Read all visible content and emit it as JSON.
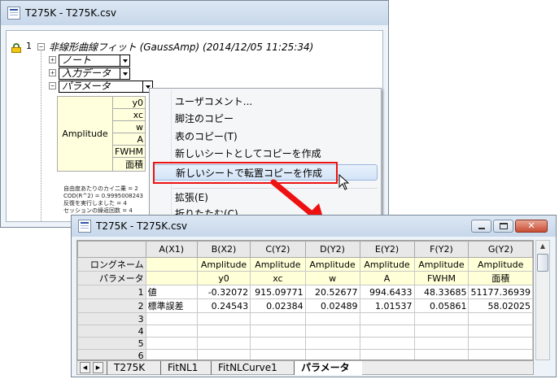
{
  "back_window": {
    "title": "T275K - T275K.csv",
    "row_number": "1",
    "report_title": "非線形曲線フィット (GaussAmp) (2014/12/05 11:25:34)",
    "tree_nodes": [
      "ノート",
      "入力データ",
      "パラメータ"
    ],
    "param_table": {
      "group": "Amplitude",
      "labels": [
        "y0",
        "xc",
        "w",
        "A",
        "FWHM",
        "面積"
      ]
    },
    "summary_lines": [
      "自由度あたりのカイ二乗 = 2",
      "COD(R^2) = 0.9995008243",
      "反復を実行しました = 4",
      "セッションの繰返回数 = 4"
    ]
  },
  "context_menu": {
    "items": [
      "ユーザコメント...",
      "脚注のコピー",
      "表のコピー(T)",
      "新しいシートとしてコピーを作成",
      "新しいシートで転置コピーを作成",
      "拡張(E)",
      "折りたたむ(C)"
    ],
    "highlighted_index": 4
  },
  "front_window": {
    "title": "T275K - T275K.csv",
    "columns": [
      "A(X1)",
      "B(X2)",
      "C(Y2)",
      "D(Y2)",
      "E(Y2)",
      "F(Y2)",
      "G(Y2)"
    ],
    "label_rows": [
      {
        "header": "ロングネーム",
        "cells": [
          "",
          "Amplitude",
          "Amplitude",
          "Amplitude",
          "Amplitude",
          "Amplitude",
          "Amplitude"
        ]
      },
      {
        "header": "パラメータ",
        "cells": [
          "",
          "y0",
          "xc",
          "w",
          "A",
          "FWHM",
          "面積"
        ]
      }
    ],
    "data_rows": [
      {
        "n": "1",
        "cells": [
          "値",
          "-0.32072",
          "915.09771",
          "20.52677",
          "994.6433",
          "48.33685",
          "51177.36939"
        ]
      },
      {
        "n": "2",
        "cells": [
          "標準誤差",
          "0.24543",
          "0.02384",
          "0.02489",
          "1.01537",
          "0.05861",
          "58.02025"
        ]
      },
      {
        "n": "3",
        "cells": [
          "",
          "",
          "",
          "",
          "",
          "",
          ""
        ]
      },
      {
        "n": "4",
        "cells": [
          "",
          "",
          "",
          "",
          "",
          "",
          ""
        ]
      },
      {
        "n": "5",
        "cells": [
          "",
          "",
          "",
          "",
          "",
          "",
          ""
        ]
      },
      {
        "n": "6",
        "cells": [
          "",
          "",
          "",
          "",
          "",
          "",
          ""
        ]
      }
    ],
    "tabs": [
      "T275K",
      "FitNL1",
      "FitNLCurve1",
      "パラメータ"
    ],
    "active_tab_index": 3
  },
  "colors": {
    "highlight_box": "#ee1111",
    "arrow": "#ee1111",
    "label_row_bg": "#ffffd8"
  }
}
